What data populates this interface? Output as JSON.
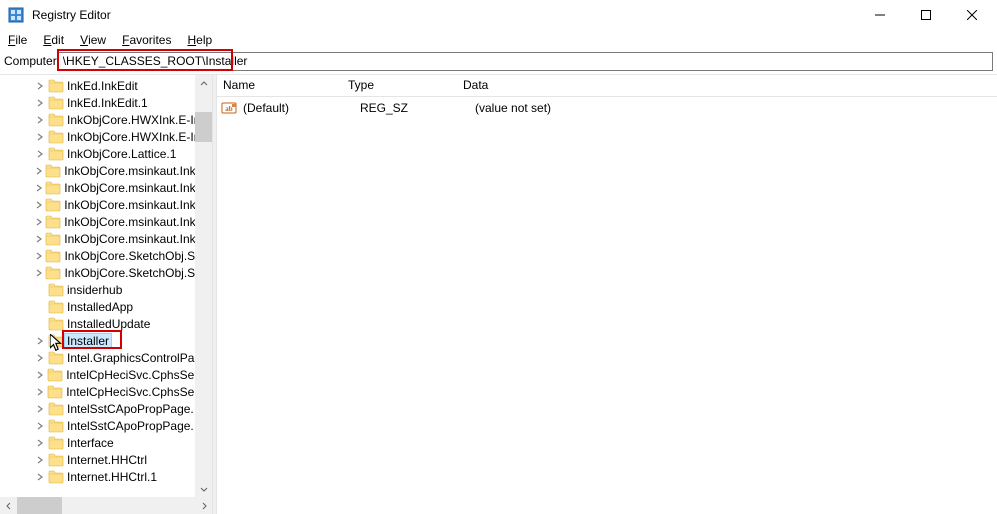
{
  "window": {
    "title": "Registry Editor"
  },
  "menu": {
    "file": "File",
    "edit": "Edit",
    "view": "View",
    "favorites": "Favorites",
    "help": "Help"
  },
  "address": {
    "label": "Computer",
    "path": "\\HKEY_CLASSES_ROOT\\Installer"
  },
  "tree": {
    "items": [
      {
        "label": "InkEd.InkEdit",
        "expandable": true,
        "selected": false
      },
      {
        "label": "InkEd.InkEdit.1",
        "expandable": true,
        "selected": false
      },
      {
        "label": "InkObjCore.HWXInk.E-Ink",
        "expandable": true,
        "selected": false
      },
      {
        "label": "InkObjCore.HWXInk.E-Ink",
        "expandable": true,
        "selected": false
      },
      {
        "label": "InkObjCore.Lattice.1",
        "expandable": true,
        "selected": false
      },
      {
        "label": "InkObjCore.msinkaut.InkCollector",
        "expandable": true,
        "selected": false
      },
      {
        "label": "InkObjCore.msinkaut.InkCollector",
        "expandable": true,
        "selected": false
      },
      {
        "label": "InkObjCore.msinkaut.InkCollector",
        "expandable": true,
        "selected": false
      },
      {
        "label": "InkObjCore.msinkaut.InkCollector",
        "expandable": true,
        "selected": false
      },
      {
        "label": "InkObjCore.msinkaut.InkCollector",
        "expandable": true,
        "selected": false
      },
      {
        "label": "InkObjCore.SketchObj.SketchInk",
        "expandable": true,
        "selected": false
      },
      {
        "label": "InkObjCore.SketchObj.SketchInk",
        "expandable": true,
        "selected": false
      },
      {
        "label": "insiderhub",
        "expandable": false,
        "selected": false
      },
      {
        "label": "InstalledApp",
        "expandable": false,
        "selected": false
      },
      {
        "label": "InstalledUpdate",
        "expandable": false,
        "selected": false
      },
      {
        "label": "Installer",
        "expandable": true,
        "selected": true
      },
      {
        "label": "Intel.GraphicsControlPanel",
        "expandable": true,
        "selected": false
      },
      {
        "label": "IntelCpHeciSvc.CphsService",
        "expandable": true,
        "selected": false
      },
      {
        "label": "IntelCpHeciSvc.CphsService",
        "expandable": true,
        "selected": false
      },
      {
        "label": "IntelSstCApoPropPage.",
        "expandable": true,
        "selected": false
      },
      {
        "label": "IntelSstCApoPropPage.",
        "expandable": true,
        "selected": false
      },
      {
        "label": "Interface",
        "expandable": true,
        "selected": false
      },
      {
        "label": "Internet.HHCtrl",
        "expandable": true,
        "selected": false
      },
      {
        "label": "Internet.HHCtrl.1",
        "expandable": true,
        "selected": false
      }
    ]
  },
  "columns": {
    "name": "Name",
    "type": "Type",
    "data": "Data"
  },
  "values": [
    {
      "name": "(Default)",
      "type": "REG_SZ",
      "data": "(value not set)",
      "icon": "string"
    }
  ]
}
